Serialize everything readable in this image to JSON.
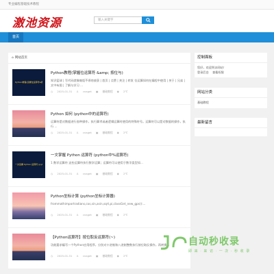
{
  "topbar": {
    "text": "专业编程基础技术教程"
  },
  "header": {
    "logo": "激池资源",
    "search_placeholder": "输入关键字"
  },
  "nav": {
    "home": "首页"
  },
  "breadcrumb": {
    "label": "网站首页"
  },
  "posts": [
    {
      "title": "Python教程(掌握位运算符 &amp; 按位与)",
      "desc": "知识篮球 | 写代码就像做饭不停地收获 | 首页 | 点赞 | 关注 | 转发 位运算如何在编程中使用 | 关于 | 兄弟 | 文中有图 | 了解与学习  ...",
      "thumb_text": "Python教程(掌握位运算符&按位与)",
      "date": "2025-01-31",
      "author": "cnaget",
      "category": "基础教程",
      "views": "2℃",
      "thumb_style": "blue"
    },
    {
      "title": "Python 如何 (python中的运算符)",
      "desc": "运算符是对数据进行各种操作，执行算术或者逻辑运算时使用的特殊符号。运算符可以是对数据的操作，执行 ...",
      "thumb_text": "",
      "date": "2025-01-31",
      "author": "cnaget",
      "category": "基础教程",
      "views": "2℃",
      "thumb_style": "sunset"
    },
    {
      "title": "一文掌握 Python 运算符 (python中%运算符)",
      "desc": "1 数学运算符 这些运算符执行数学运算；运算符可以使用于数字类型如...",
      "thumb_text": "一文掌握 Python 运算符 (python中%运算符)",
      "date": "2025-01-31",
      "author": "cnaget",
      "category": "基础教程",
      "views": "2℃",
      "thumb_style": "blue"
    },
    {
      "title": "Python坐标计算 (python坐标计算器)",
      "desc": "frommathimportradians,cos,sin,asin,sqrt,pi,classGet_new_gps():...",
      "thumb_text": "",
      "date": "2025-01-31",
      "author": "cnaget",
      "category": "基础教程",
      "views": "2℃",
      "thumb_style": "mtn"
    },
    {
      "title": "【Python运算符】按位取反运算符(~)",
      "desc": "功能要求编写一个Python应用程序，分别对十进制和八进制整数执行按位取反操作，再转换...",
      "thumb_text": "",
      "date": "2025-01-31",
      "author": "cnaget",
      "category": "基础教程",
      "views": "2℃",
      "thumb_style": "sunset"
    }
  ],
  "sidebar": {
    "panel_title": "控制面板",
    "panel_lines": [
      "您好，欢迎到访网站！",
      "登录后台",
      "查看权限"
    ],
    "cat_title": "网站分类",
    "cat_items": [
      "基础教程"
    ],
    "latest_title": "最新留言"
  },
  "watermark": {
    "text": "自动秒收录",
    "sub": "即 来 · 来 访 · 一 次 · 秒 收 录"
  }
}
